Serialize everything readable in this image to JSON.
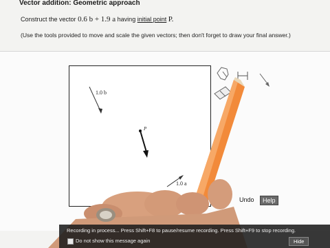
{
  "header": {
    "title": "Vector addition: Geometric approach",
    "instr_prefix": "Construct the vector",
    "instr_expr": "0.6 b + 1.9 a",
    "instr_mid": "having",
    "instr_link": "initial point",
    "instr_point": "P.",
    "note": "(Use the tools provided to move and scale the given vectors; then don't forget to draw your final answer.)"
  },
  "canvas": {
    "vector_b_label": "1.0 b",
    "vector_a_label": "1.0 a",
    "point_label": "P"
  },
  "toolbar": {
    "undo_label": "Undo",
    "help_label": "Help"
  },
  "recording": {
    "message": "Recording in process... Press Shift+F8 to pause/resume recording. Press Shift+F9 to stop recording.",
    "checkbox_label": "Do not show this message again",
    "hide_label": "Hide"
  }
}
